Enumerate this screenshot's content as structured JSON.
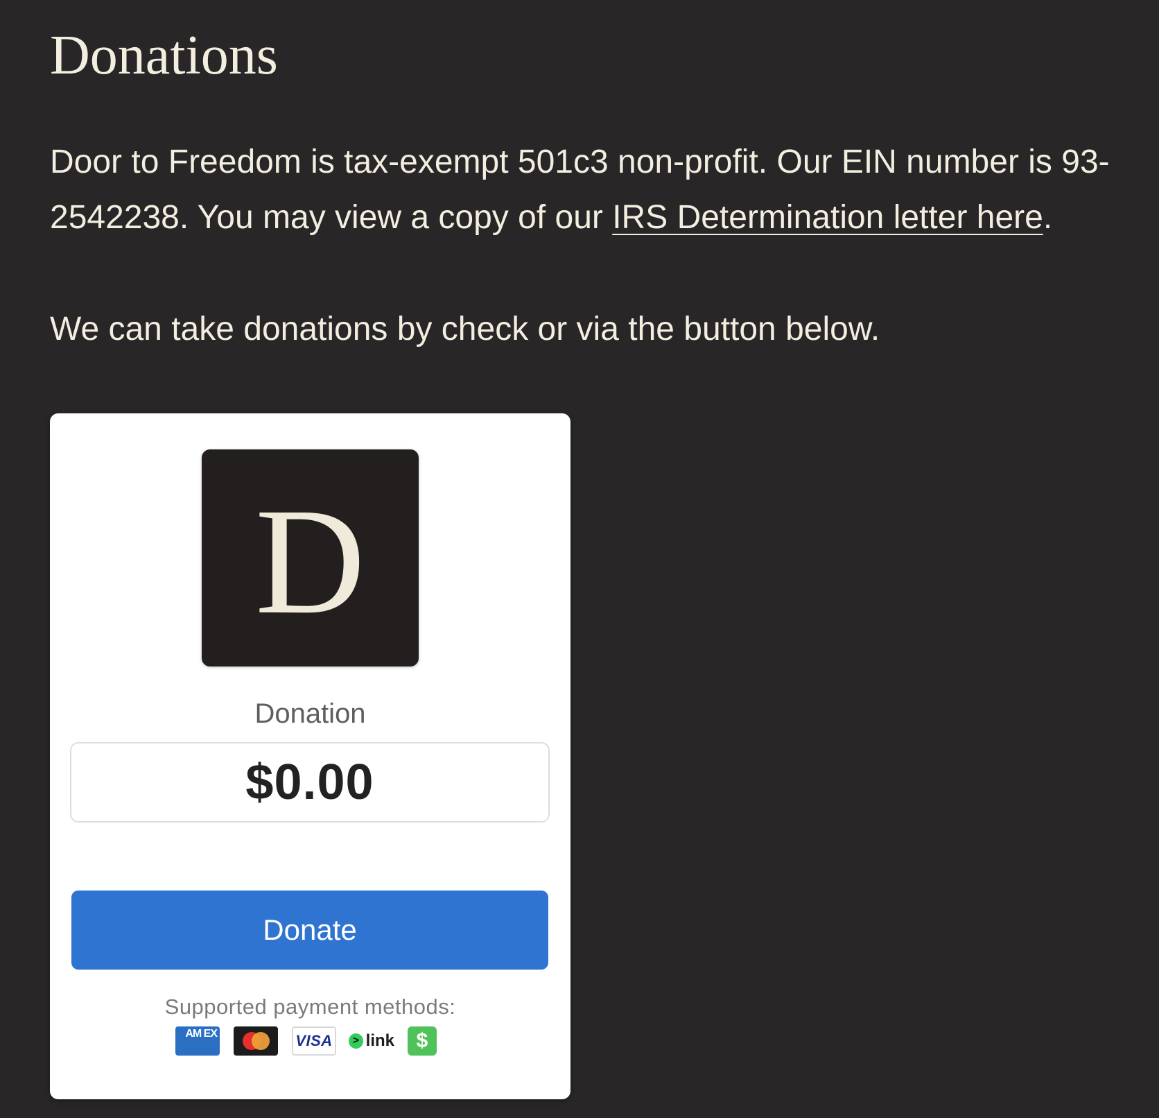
{
  "page": {
    "title": "Donations",
    "intro_text": "Door to Freedom is tax-exempt 501c3 non-profit. Our EIN number is 93-2542238. You may view a copy of our ",
    "irs_link_text": "IRS Determination letter here",
    "intro_end": ".",
    "checks_text": "We can take donations by check or via the button below."
  },
  "donate_card": {
    "logo_letter": "D",
    "product_name": "Donation",
    "amount": "$0.00",
    "button_label": "Donate",
    "methods_label": "Supported payment methods:",
    "payment_methods": {
      "amex": "AM EX",
      "visa": "VISA",
      "link_arrow": ">",
      "link": "link",
      "cashapp": "$"
    }
  },
  "colors": {
    "page_background": "#282627",
    "text_cream": "#f3eee0",
    "button_blue": "#2f74d0",
    "logo_background": "#231f1f"
  }
}
